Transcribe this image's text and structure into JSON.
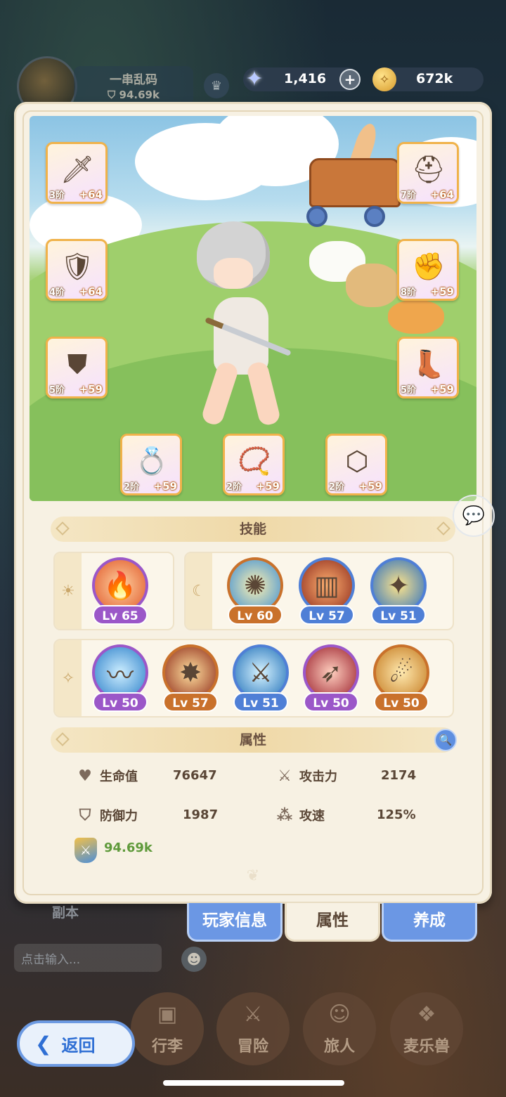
{
  "hud": {
    "player_name": "一串乱码",
    "player_power": "94.69k",
    "gems": "1,416",
    "gold": "672k"
  },
  "equipment": [
    {
      "slot": "weapon",
      "tier": "3阶",
      "bonus": "+64",
      "icon": "sword-icon"
    },
    {
      "slot": "chest",
      "tier": "4阶",
      "bonus": "+64",
      "icon": "armor-icon"
    },
    {
      "slot": "pants",
      "tier": "5阶",
      "bonus": "+59",
      "icon": "pants-icon"
    },
    {
      "slot": "helmet",
      "tier": "7阶",
      "bonus": "+64",
      "icon": "helmet-icon"
    },
    {
      "slot": "gloves",
      "tier": "8阶",
      "bonus": "+59",
      "icon": "gloves-icon"
    },
    {
      "slot": "boots",
      "tier": "5阶",
      "bonus": "+59",
      "icon": "boots-icon"
    },
    {
      "slot": "ring",
      "tier": "2阶",
      "bonus": "+59",
      "icon": "ring-icon"
    },
    {
      "slot": "necklace",
      "tier": "2阶",
      "bonus": "+59",
      "icon": "necklace-icon"
    },
    {
      "slot": "amulet",
      "tier": "2阶",
      "bonus": "+59",
      "icon": "amulet-icon"
    }
  ],
  "skills": {
    "title": "技能",
    "sun_group": [
      {
        "level": "Lv 65",
        "color": "#9b57c8"
      }
    ],
    "moon_group": [
      {
        "level": "Lv 60",
        "color": "#c9712b"
      },
      {
        "level": "Lv 57",
        "color": "#4f7fd6"
      },
      {
        "level": "Lv 51",
        "color": "#4f7fd6"
      }
    ],
    "star_group": [
      {
        "level": "Lv 50",
        "color": "#9b57c8"
      },
      {
        "level": "Lv 57",
        "color": "#c9712b"
      },
      {
        "level": "Lv 51",
        "color": "#4f7fd6"
      },
      {
        "level": "Lv 50",
        "color": "#9b57c8"
      },
      {
        "level": "Lv 50",
        "color": "#c9712b"
      }
    ]
  },
  "attributes": {
    "title": "属性",
    "hp_label": "生命值",
    "hp_value": "76647",
    "atk_label": "攻击力",
    "atk_value": "2174",
    "def_label": "防御力",
    "def_value": "1987",
    "spd_label": "攻速",
    "spd_value": "125%",
    "power_value": "94.69k"
  },
  "tabs": {
    "player_info": "玩家信息",
    "attributes": "属性",
    "growth": "养成"
  },
  "bottom": {
    "dungeon_label": "副本",
    "chat_placeholder": "点击输入...",
    "back_label": "返回",
    "nav": [
      "行李",
      "冒险",
      "旅人",
      "麦乐兽"
    ]
  }
}
